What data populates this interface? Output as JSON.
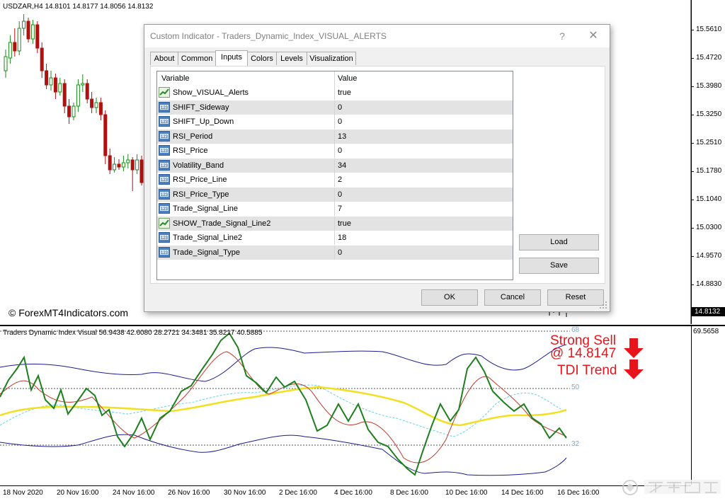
{
  "chart": {
    "symbol_line": "USDZAR,H4  14.8101 14.8177 14.8056 14.8132",
    "watermark": "© ForexMT4Indicators.com",
    "price_ticks": [
      "15.5610",
      "15.4720",
      "15.3980",
      "15.3250",
      "15.2510",
      "15.1780",
      "15.1040",
      "15.0300",
      "14.9570",
      "14.8830"
    ],
    "current_price": "14.8132",
    "colors": {
      "bull_candle": "#1a8a1a",
      "bear_candle": "#b01010",
      "background": "#ffffff"
    }
  },
  "indicator": {
    "title": "Traders Dynamic Index Visual 56.9438 42.6080 28.2721 34.3481 35.8217 40.5885",
    "axis_value": "69.5658",
    "levels": [
      "68",
      "50",
      "32"
    ],
    "alert_lines": [
      "Strong Sell",
      "@ 14.8147",
      "TDI Trend"
    ],
    "colors": {
      "rsi_line": "#1e7f1e",
      "signal_line": "#c0392b",
      "market_base": "#f2e020",
      "volatility_band": "#1c1c8c",
      "mid_band": "#6ad0e8",
      "alert": "#e8141c"
    }
  },
  "time_axis": [
    "18 Nov 2020",
    "20 Nov 16:00",
    "24 Nov 16:00",
    "26 Nov 16:00",
    "30 Nov 16:00",
    "2 Dec 16:00",
    "4 Dec 16:00",
    "8 Dec 16:00",
    "10 Dec 16:00",
    "14 Dec 16:00",
    "16 Dec 16:00"
  ],
  "dialog": {
    "title": "Custom Indicator - Traders_Dynamic_Index_VISUAL_ALERTS",
    "help_glyph": "?",
    "close_glyph": "✕",
    "tabs": [
      "About",
      "Common",
      "Inputs",
      "Colors",
      "Levels",
      "Visualization"
    ],
    "active_tab": "Inputs",
    "grid_header": {
      "variable": "Variable",
      "value": "Value"
    },
    "inputs": [
      {
        "name": "Show_VISUAL_Alerts",
        "value": "true",
        "icon": "bool-icon"
      },
      {
        "name": "SHIFT_Sideway",
        "value": "0",
        "icon": "int-icon"
      },
      {
        "name": "SHIFT_Up_Down",
        "value": "0",
        "icon": "int-icon"
      },
      {
        "name": "RSI_Period",
        "value": "13",
        "icon": "int-icon"
      },
      {
        "name": "RSI_Price",
        "value": "0",
        "icon": "int-icon"
      },
      {
        "name": "Volatility_Band",
        "value": "34",
        "icon": "int-icon"
      },
      {
        "name": "RSI_Price_Line",
        "value": "2",
        "icon": "int-icon"
      },
      {
        "name": "RSI_Price_Type",
        "value": "0",
        "icon": "int-icon"
      },
      {
        "name": "Trade_Signal_Line",
        "value": "7",
        "icon": "int-icon"
      },
      {
        "name": "SHOW_Trade_Signal_Line2",
        "value": "true",
        "icon": "bool-icon"
      },
      {
        "name": "Trade_Signal_Line2",
        "value": "18",
        "icon": "int-icon"
      },
      {
        "name": "Trade_Signal_Type",
        "value": "0",
        "icon": "int-icon"
      }
    ],
    "buttons": {
      "load": "Load",
      "save": "Save",
      "ok": "OK",
      "cancel": "Cancel",
      "reset": "Reset"
    }
  }
}
